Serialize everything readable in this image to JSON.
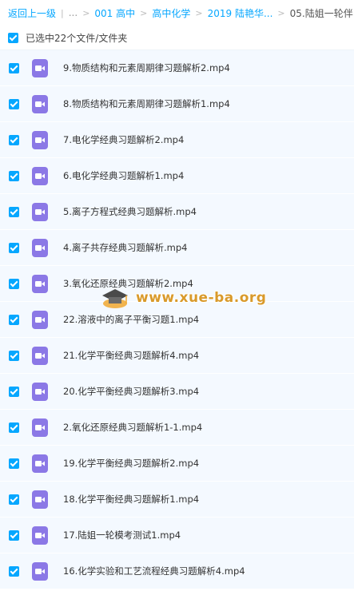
{
  "breadcrumb": {
    "back": "返回上一级",
    "ellipsis": "...",
    "items": [
      "001 高中",
      "高中化学",
      "2019 陆艳华...",
      "05.陆姐一轮伴..."
    ],
    "separator": ">"
  },
  "selection": {
    "label": "已选中22个文件/文件夹"
  },
  "files": [
    "9.物质结构和元素周期律习题解析2.mp4",
    "8.物质结构和元素周期律习题解析1.mp4",
    "7.电化学经典习题解析2.mp4",
    "6.电化学经典习题解析1.mp4",
    "5.离子方程式经典习题解析.mp4",
    "4.离子共存经典习题解析.mp4",
    "3.氧化还原经典习题解析2.mp4",
    "22.溶液中的离子平衡习题1.mp4",
    "21.化学平衡经典习题解析4.mp4",
    "20.化学平衡经典习题解析3.mp4",
    "2.氧化还原经典习题解析1-1.mp4",
    "19.化学平衡经典习题解析2.mp4",
    "18.化学平衡经典习题解析1.mp4",
    "17.陆姐一轮模考测试1.mp4",
    "16.化学实验和工艺流程经典习题解析4.mp4"
  ],
  "watermark": {
    "text": "www.xue-ba.org"
  },
  "colors": {
    "accent": "#06a7ff",
    "row_bg": "#f4f9ff",
    "video_icon": "#8b78e6",
    "watermark": "#d99a2b"
  },
  "icons": {
    "checkbox": "checkbox-checked-icon",
    "file": "video-file-icon"
  }
}
